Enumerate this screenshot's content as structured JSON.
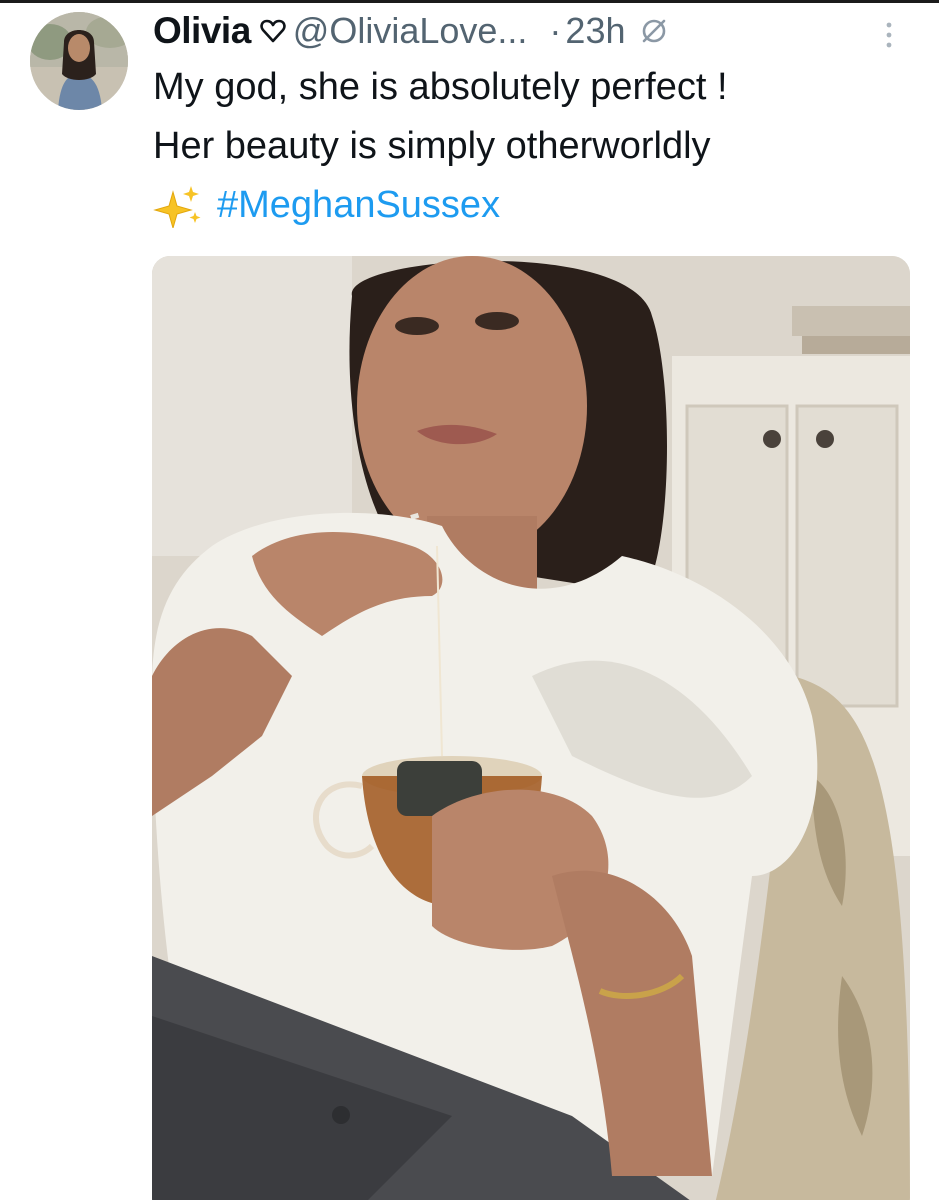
{
  "tweet": {
    "author_name": "Olivia",
    "author_handle": "@OliviaLove...",
    "time_separator": "·",
    "timestamp": "23h",
    "text_lines": [
      "My god, she is absolutely perfect !",
      "Her beauty is simply otherworldly"
    ],
    "hashtag": "#MeghanSussex",
    "icons": {
      "badge": "heart-outline-icon",
      "edited": "no-entry-icon",
      "more": "vertical-ellipsis-icon",
      "emoji": "sparkles-icon"
    },
    "colors": {
      "text": "#0f1419",
      "secondary": "#536471",
      "link": "#1d9bf0"
    }
  }
}
